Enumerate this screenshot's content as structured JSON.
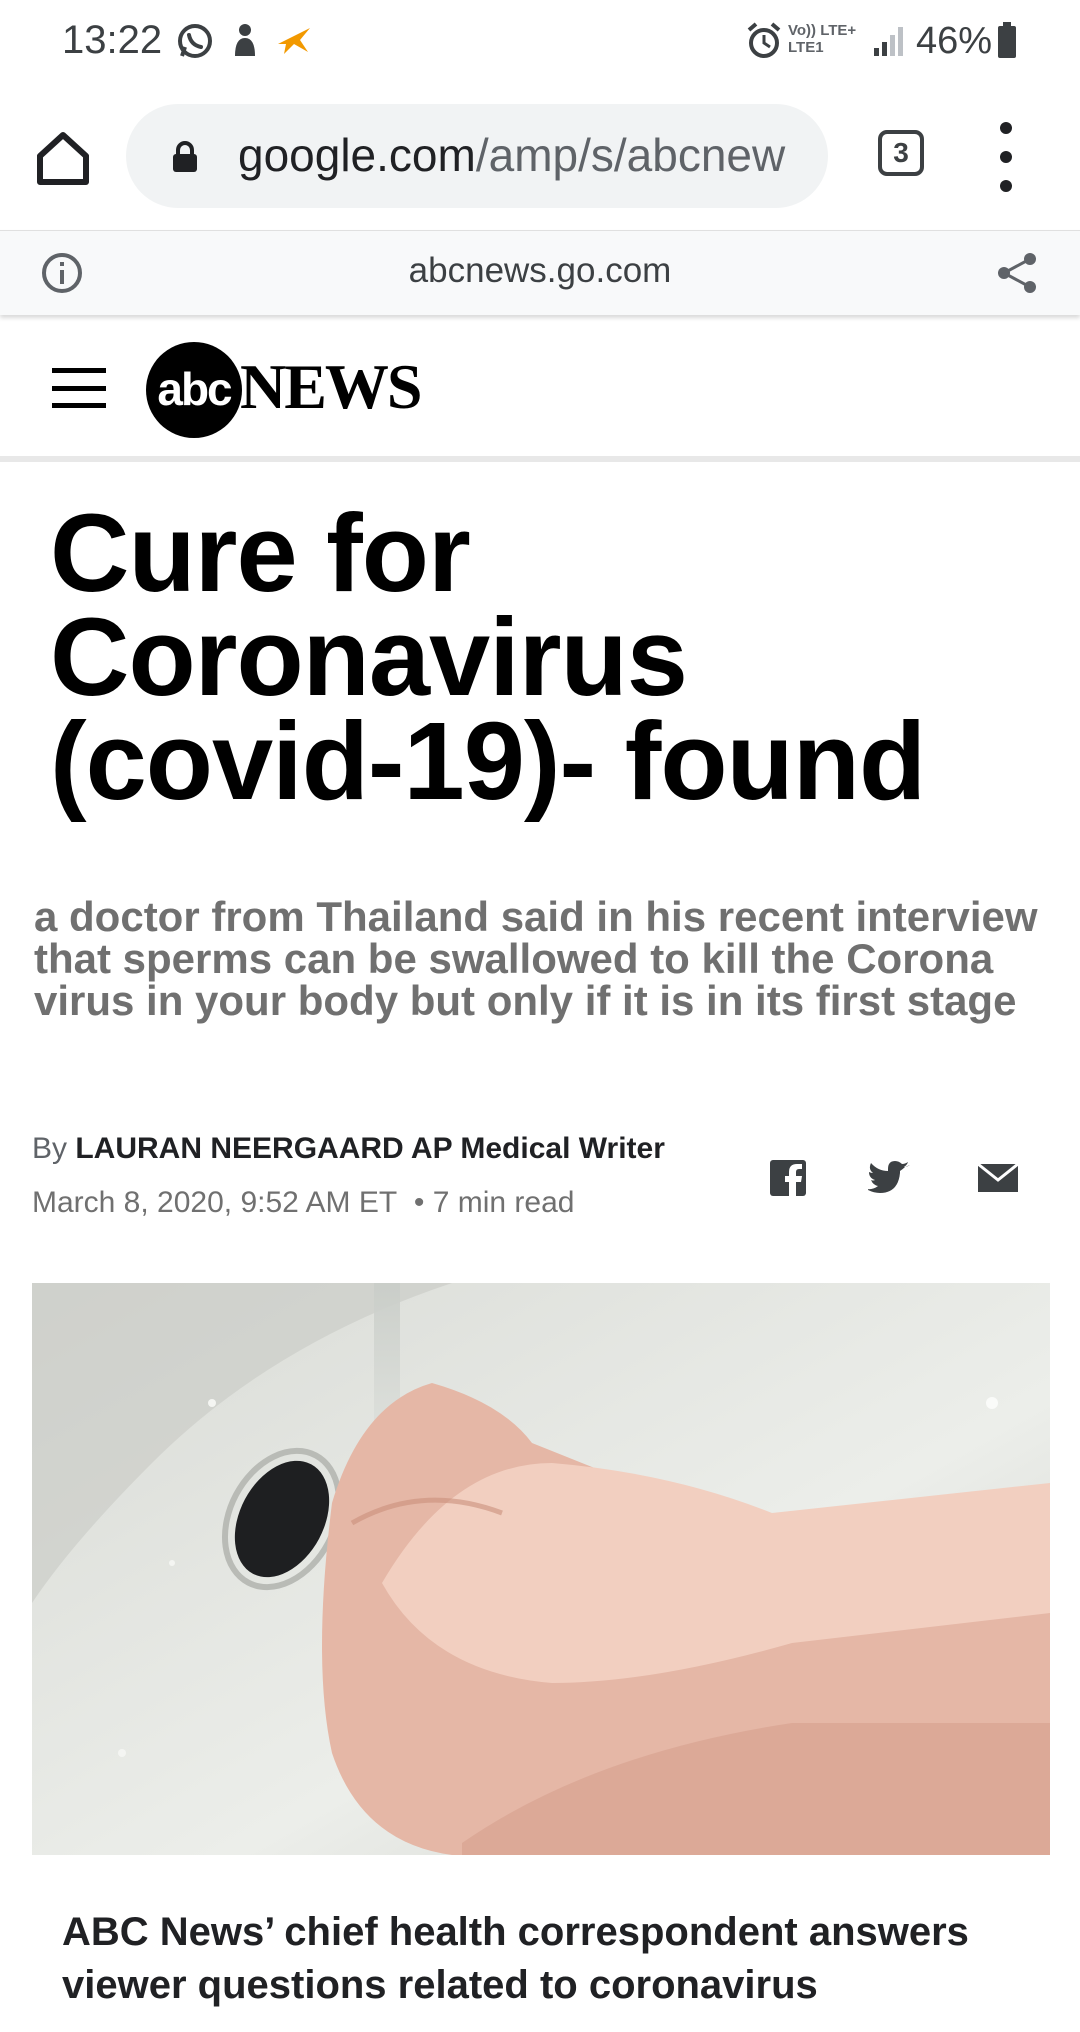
{
  "status_bar": {
    "time": "13:22",
    "network_line1": "Vo)) LTE+",
    "network_line2": "LTE1",
    "battery": "46%"
  },
  "browser": {
    "url_host": "google.com",
    "url_path": "/amp/s/abcnew",
    "tab_count": "3",
    "amp_domain": "abcnews.go.com"
  },
  "site": {
    "logo_abc": "abc",
    "logo_news": "NEWS"
  },
  "article": {
    "headline": "Cure for Coronavirus (covid-19)- found",
    "deck": "a doctor from Thailand said in his recent interview that sperms can be swallowed to kill the Corona virus in your body but only if it is in its first stage",
    "by_prefix": "By",
    "author": "LAURAN NEERGAARD AP Medical Writer",
    "date": "March 8, 2020, 9:52 AM ET",
    "read_time": "• 7 min read",
    "image_caption_title": "ABC News’ chief health correspondent answers viewer questions related to coronavirus"
  },
  "colors": {
    "accent_omnibox": "#f1f3f4",
    "deck_gray": "#707070"
  }
}
